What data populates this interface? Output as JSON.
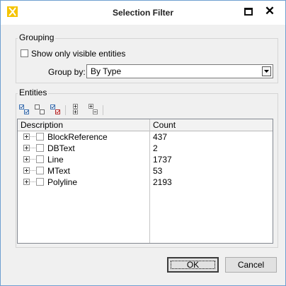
{
  "window": {
    "title": "Selection Filter",
    "accent_color": "#f5c400"
  },
  "grouping": {
    "label": "Grouping",
    "show_visible_label": "Show only visible entities",
    "show_visible_checked": false,
    "group_by_label": "Group by:",
    "group_by_value": "By Type"
  },
  "entities": {
    "label": "Entities",
    "toolbar": [
      "check-all-icon",
      "uncheck-all-icon",
      "invert-check-icon",
      "expand-all-icon",
      "collapse-all-icon"
    ],
    "columns": [
      "Description",
      "Count"
    ],
    "rows": [
      {
        "description": "BlockReference",
        "count": "437"
      },
      {
        "description": "DBText",
        "count": "2"
      },
      {
        "description": "Line",
        "count": "1737"
      },
      {
        "description": "MText",
        "count": "53"
      },
      {
        "description": "Polyline",
        "count": "2193"
      }
    ]
  },
  "buttons": {
    "ok": "OK",
    "cancel": "Cancel"
  }
}
